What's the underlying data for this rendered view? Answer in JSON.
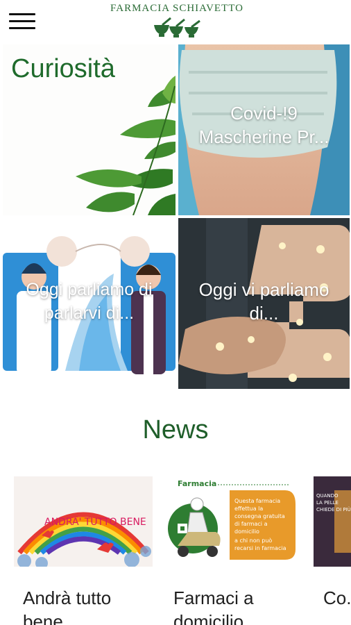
{
  "header": {
    "brand": "FARMACIA SCHIAVETTO",
    "menu_icon": "hamburger-menu-icon",
    "logo_icon": "mortar-pestle-icon"
  },
  "curiosita": {
    "title": "Curiosità",
    "tiles": [
      {
        "caption": "Covid-!9 Mascherine Pr..."
      },
      {
        "caption": "Oggi parliamo di parlarvi di..."
      },
      {
        "caption": "Oggi vi parliamo di..."
      }
    ]
  },
  "news": {
    "title": "News",
    "cards": [
      {
        "label": "Andrà tutto bene",
        "image_text": "ANDRA' TUTTO BENE"
      },
      {
        "label": "Farmaci a domicilio",
        "image_header": "Farmacia",
        "image_text": "Questa farmacia effettua la consegna gratuita di farmaci a domicilio a chi non può recarsi in farmacia"
      },
      {
        "label": "Co... un...",
        "image_text": "QUANDO LA PELLE CHIEDE DI PIÙ"
      }
    ]
  },
  "colors": {
    "brand_green": "#1f6b2c",
    "accent_orange": "#e89a2a",
    "mask_blue": "#4ba3c7"
  }
}
